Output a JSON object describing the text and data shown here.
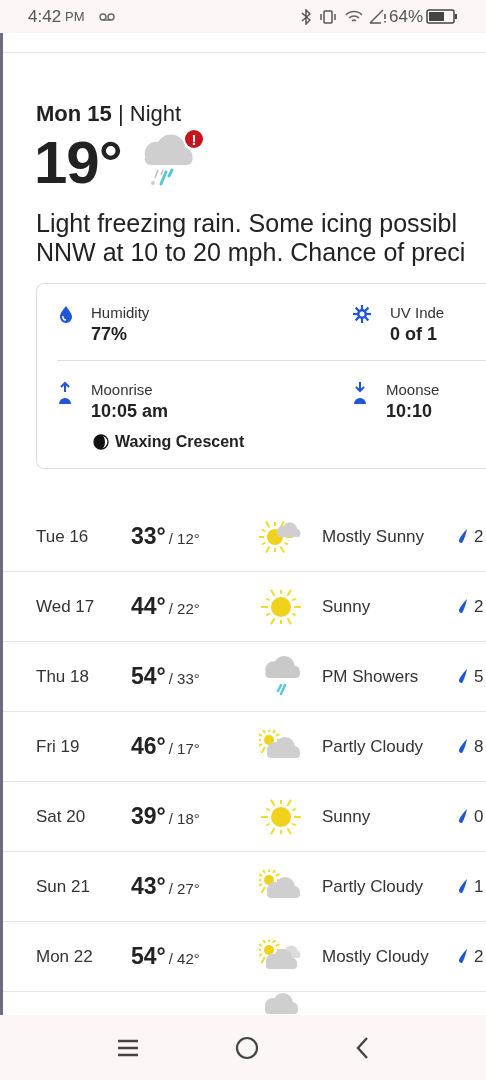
{
  "status_bar": {
    "time": "4:42",
    "ampm": "PM",
    "battery": "64%"
  },
  "current": {
    "day": "Mon 15",
    "separator": "|",
    "period": "Night",
    "temperature": "19°",
    "alert": "!",
    "description": [
      "Light freezing rain. Some icing possibl",
      "NNW at 10 to 20 mph. Chance of preci"
    ]
  },
  "details": [
    {
      "kind": "humidity",
      "label": "Humidity",
      "value": "77%"
    },
    {
      "kind": "uv",
      "label": "UV Inde",
      "value": "0 of 1"
    },
    {
      "kind": "moonrise",
      "label": "Moonrise",
      "value": "10:05 am"
    },
    {
      "kind": "moonset",
      "label": "Moonse",
      "value": "10:10"
    }
  ],
  "moon_phase": "Waxing Crescent",
  "forecast": [
    {
      "day": "Tue 16",
      "high": "33°",
      "low": "/ 12°",
      "kind": "mostly-sunny",
      "condition": "Mostly Sunny",
      "precip": "2"
    },
    {
      "day": "Wed 17",
      "high": "44°",
      "low": "/ 22°",
      "kind": "sunny",
      "condition": "Sunny",
      "precip": "2"
    },
    {
      "day": "Thu 18",
      "high": "54°",
      "low": "/ 33°",
      "kind": "showers",
      "condition": "PM Showers",
      "precip": "5"
    },
    {
      "day": "Fri 19",
      "high": "46°",
      "low": "/ 17°",
      "kind": "partly-cloudy",
      "condition": "Partly Cloudy",
      "precip": "8"
    },
    {
      "day": "Sat 20",
      "high": "39°",
      "low": "/ 18°",
      "kind": "sunny",
      "condition": "Sunny",
      "precip": "0"
    },
    {
      "day": "Sun 21",
      "high": "43°",
      "low": "/ 27°",
      "kind": "partly-cloudy",
      "condition": "Partly Cloudy",
      "precip": "1"
    },
    {
      "day": "Mon 22",
      "high": "54°",
      "low": "/ 42°",
      "kind": "mostly-cloudy",
      "condition": "Mostly Cloudy",
      "precip": "2"
    },
    {
      "kind": "cloudy"
    }
  ]
}
